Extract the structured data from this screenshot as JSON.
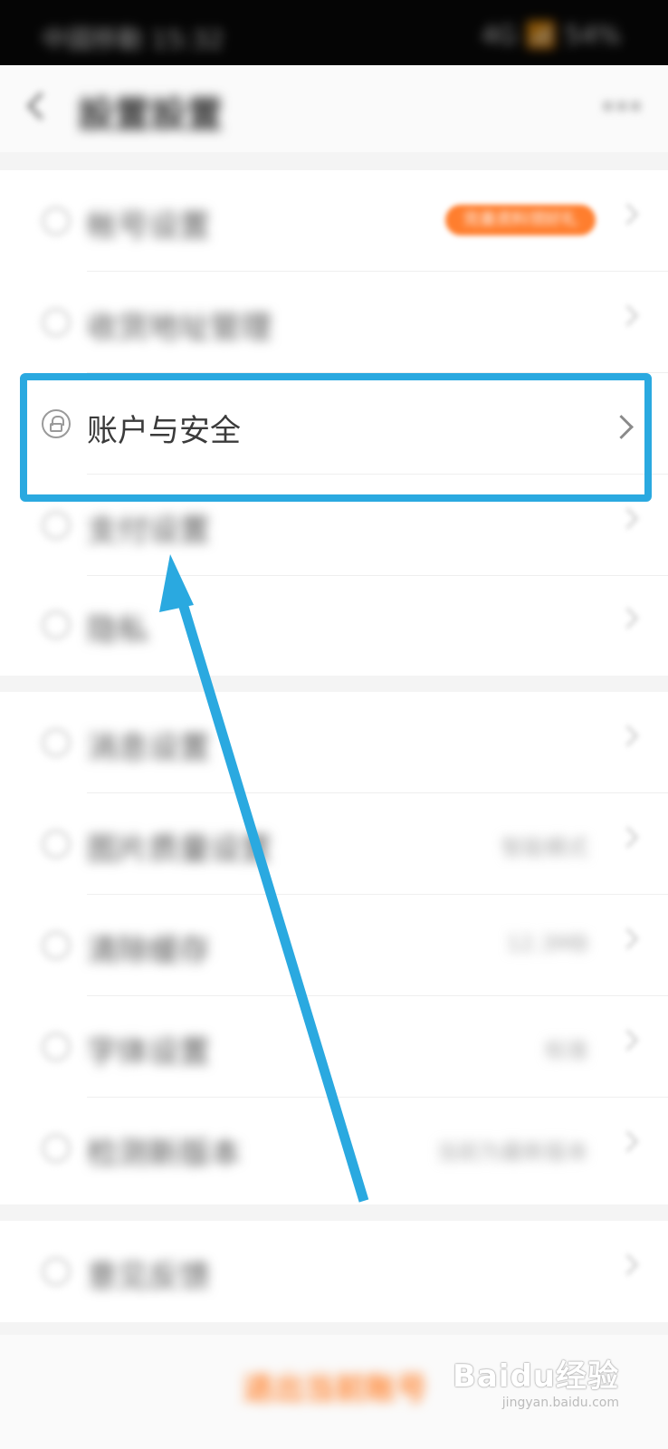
{
  "status_bar": {
    "left": "中國移動 15:32",
    "right": "4G 📶 54%"
  },
  "header": {
    "title": "設置設置",
    "more": "•••"
  },
  "section1": [
    {
      "label": "帐号设置",
      "value": "",
      "badge": "完善资料领好礼"
    },
    {
      "label": "收货地址管理",
      "value": ""
    }
  ],
  "highlight": {
    "label": "账户与安全"
  },
  "section1b": [
    {
      "label": "支付设置",
      "value": ""
    },
    {
      "label": "隐私",
      "value": ""
    }
  ],
  "section2": [
    {
      "label": "消息设置",
      "value": ""
    },
    {
      "label": "图片质量设置",
      "value": "智能模式"
    },
    {
      "label": "清除缓存",
      "value": "12.3MB"
    },
    {
      "label": "字体设置",
      "value": "标准"
    },
    {
      "label": "检测新版本",
      "value": "当前为最新版本"
    }
  ],
  "section3": [
    {
      "label": "意见反馈",
      "value": ""
    }
  ],
  "logout": {
    "label": "退出当前账号"
  },
  "watermark": {
    "main": "Baidu经验",
    "sub": "jingyan.baidu.com"
  },
  "colors": {
    "highlight": "#2aa9e0",
    "accent": "#ff7e2e"
  }
}
